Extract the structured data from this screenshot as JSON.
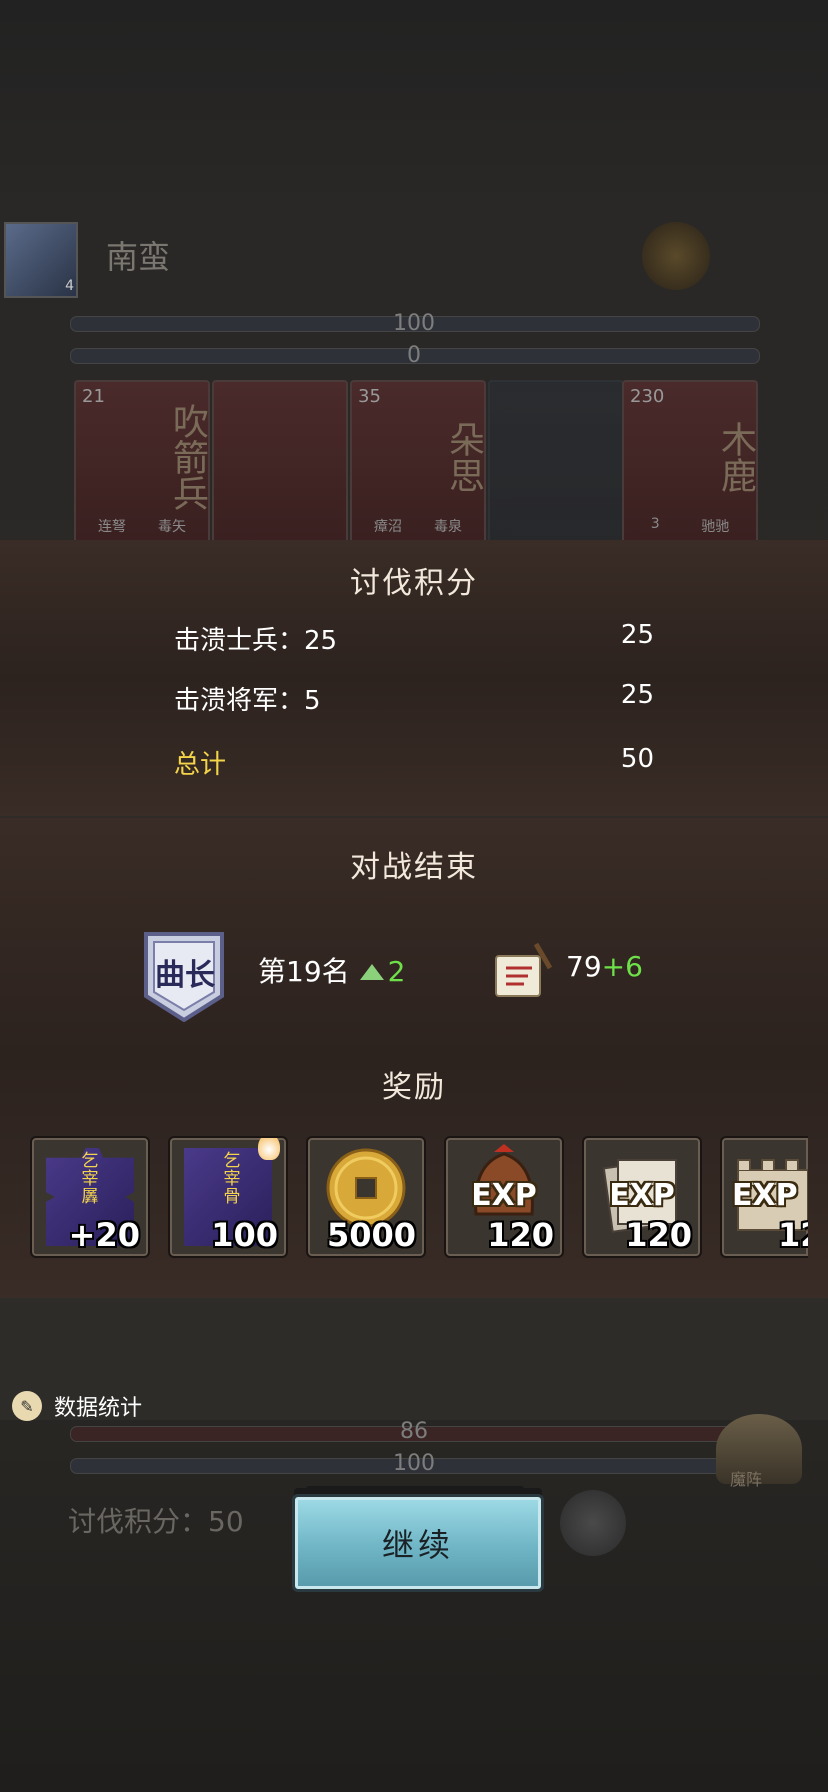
{
  "background": {
    "enemy_name": "南蛮",
    "avatar_level": "4",
    "top_bar_1": "100",
    "top_bar_2": "0",
    "enemy_cards": [
      {
        "num": "21",
        "name": "吹箭兵",
        "tags": [
          "连弩",
          "毒矢"
        ]
      },
      {
        "num": "",
        "name": "",
        "tags": []
      },
      {
        "num": "35",
        "name": "朵思",
        "tags": [
          "瘴沼",
          "毒泉"
        ]
      },
      {
        "num": "",
        "name": "",
        "tags": []
      },
      {
        "num": "230",
        "name": "木鹿",
        "tags": [
          "3",
          "驰驰"
        ]
      }
    ],
    "bottom_bar_1": "86",
    "bottom_bar_2": "100",
    "bottom_score": "讨伐积分：50",
    "fan_label": "魔阵"
  },
  "score_panel": {
    "title": "讨伐积分",
    "rows": [
      {
        "label": "击溃士兵：25",
        "value": "25"
      },
      {
        "label": "击溃将军：5",
        "value": "25"
      }
    ],
    "total_label": "总计",
    "total_value": "50"
  },
  "battle_panel": {
    "title": "对战结束",
    "rank_badge": "曲长",
    "rank_text": "第19名",
    "rank_change": "2",
    "points": "79",
    "points_change": "+6",
    "rewards_title": "奖励",
    "rewards": [
      {
        "icon": "purple-fragment-icon",
        "qty": "+20",
        "text": "乞宰羼"
      },
      {
        "icon": "purple-card-icon",
        "qty": "100",
        "text": "乞宰骨"
      },
      {
        "icon": "coin-icon",
        "qty": "5000"
      },
      {
        "icon": "helmet-exp-icon",
        "qty": "120",
        "label": "EXP"
      },
      {
        "icon": "book-exp-icon",
        "qty": "120",
        "label": "EXP"
      },
      {
        "icon": "wall-exp-icon",
        "qty": "12",
        "label": "EXP"
      }
    ]
  },
  "stats_link": "数据统计",
  "continue_button": "继续",
  "colors": {
    "gold": "#f4d44a",
    "green": "#6ee04a",
    "button": "#7fc3d2"
  }
}
